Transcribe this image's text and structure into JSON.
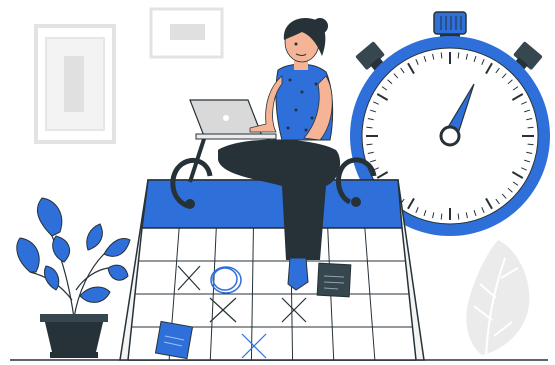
{
  "colors": {
    "accent": "#2f6fda",
    "accent_light": "#4d8df0",
    "dark": "#263238",
    "outline": "#263238",
    "skin": "#f5b495",
    "frame": "#e6e6e6",
    "leaf_gray": "#ebebeb",
    "laptop": "#d9d9d9"
  },
  "icons": {
    "clock": "stopwatch-icon",
    "calendar": "calendar-icon",
    "plant": "potted-plant-icon",
    "person": "woman-with-laptop-icon"
  }
}
